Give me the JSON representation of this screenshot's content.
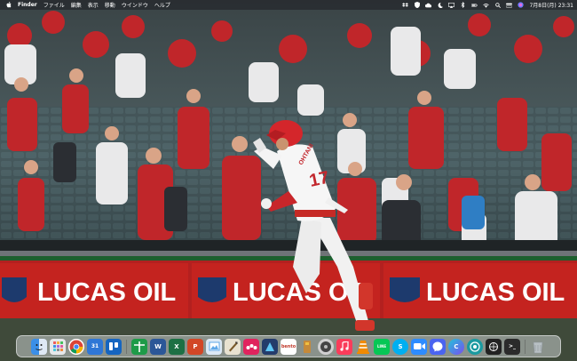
{
  "menubar": {
    "app_name": "Finder",
    "menus": [
      "ファイル",
      "編集",
      "表示",
      "移動",
      "ウインドウ",
      "ヘルプ"
    ],
    "date": "7月8日(月)",
    "time": "23:31"
  },
  "wallpaper": {
    "banner_text": "LUCAS OIL",
    "jersey_name": "OHTANI",
    "jersey_number": "17"
  },
  "dock": {
    "apps": [
      {
        "name": "Finder",
        "icon": "finder-icon",
        "color": "#3b8fe8"
      },
      {
        "name": "Launchpad",
        "icon": "launchpad-icon",
        "color": "#6f7a86"
      },
      {
        "name": "Google Chrome",
        "icon": "chrome-icon",
        "color": "#ffffff"
      },
      {
        "name": "Calendar",
        "icon": "calendar-icon",
        "color": "#2f77d6"
      },
      {
        "name": "Trello",
        "icon": "trello-icon",
        "color": "#1565c0"
      },
      {
        "name": "Numbers",
        "icon": "numbers-icon",
        "color": "#1e9b48"
      },
      {
        "name": "Microsoft Word",
        "icon": "word-icon",
        "color": "#2b5797"
      },
      {
        "name": "Microsoft Excel",
        "icon": "excel-icon",
        "color": "#1d7044"
      },
      {
        "name": "Microsoft PowerPoint",
        "icon": "powerpoint-icon",
        "color": "#d24726"
      },
      {
        "name": "Preview",
        "icon": "preview-icon",
        "color": "#5fa8e8"
      },
      {
        "name": "Script Editor",
        "icon": "script-editor-icon",
        "color": "#c9c9c9"
      },
      {
        "name": "Monday",
        "icon": "monday-icon",
        "color": "#e0245e"
      },
      {
        "name": "Affinity Designer",
        "icon": "affinity-icon",
        "color": "#243c6b"
      },
      {
        "name": "Bento",
        "icon": "bento-icon",
        "color": "#ffffff",
        "label": "bento"
      },
      {
        "name": "Stickies",
        "icon": "stickies-icon",
        "color": "#f0c040"
      },
      {
        "name": "Music Utility",
        "icon": "music-utility-icon",
        "color": "#444444"
      },
      {
        "name": "Music",
        "icon": "music-icon",
        "color": "#fa3c5a"
      },
      {
        "name": "VLC",
        "icon": "vlc-icon",
        "color": "#f08a00"
      },
      {
        "name": "LINE",
        "icon": "line-icon",
        "color": "#06c755"
      },
      {
        "name": "Skype",
        "icon": "skype-icon",
        "color": "#00aff0"
      },
      {
        "name": "Zoom",
        "icon": "zoom-icon",
        "color": "#2d8cff"
      },
      {
        "name": "Messenger",
        "icon": "messenger-icon",
        "color": "#4a64f0"
      },
      {
        "name": "Canva",
        "icon": "canva-icon",
        "color": "#2d83d0"
      },
      {
        "name": "App 1",
        "icon": "circle-app-icon",
        "color": "#1a9aa0"
      },
      {
        "name": "ChatGPT",
        "icon": "chatgpt-icon",
        "color": "#222222"
      },
      {
        "name": "Trash",
        "icon": "trash-icon",
        "color": "#9aa3a8"
      }
    ]
  }
}
